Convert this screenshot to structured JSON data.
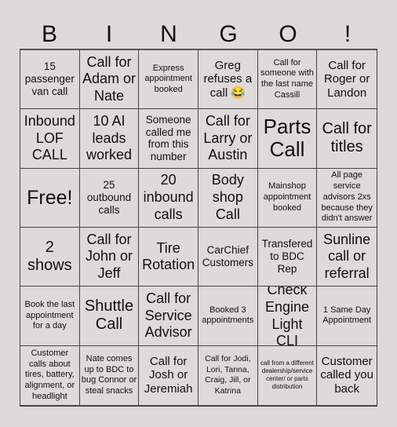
{
  "header": {
    "letters": [
      "B",
      "I",
      "N",
      "G",
      "O",
      "!"
    ]
  },
  "cells": [
    [
      "15 passenger van call",
      "Call for Adam or Nate",
      "Express appointment booked",
      "Greg refuses a call 😂",
      "Call for someone with the last name Cassill",
      "Call for Roger or Landon"
    ],
    [
      "Inbound LOF CALL",
      "10 AI leads worked",
      "Someone called me from this number",
      "Call for Larry or Austin",
      "Parts Call",
      "Call for titles"
    ],
    [
      "Free!",
      "25 outbound calls",
      "20 inbound calls",
      "Body shop Call",
      "Mainshop appointment booked",
      "All page service advisors 2xs because they didn't answer"
    ],
    [
      "2 shows",
      "Call for John or Jeff",
      "Tire Rotation",
      "CarChief Customers",
      "Transfered to BDC Rep",
      "Sunline call or referral"
    ],
    [
      "Book the last appointment for a day",
      "Shuttle Call",
      "Call for Service Advisor",
      "Booked 3 appointments",
      "Check Engine Light CLI",
      "1 Same Day Appointment"
    ],
    [
      "Customer calls about tires, battery, alignment, or headlight",
      "Nate comes up to BDC to bug Connor or steal snacks",
      "Call for Josh or Jeremiah",
      "Call for Jodi, Lori, Tanna, Craig, Jill, or Katrina",
      "call from a different dealership/service center/ or parts distribution",
      "Customer called you back"
    ]
  ]
}
